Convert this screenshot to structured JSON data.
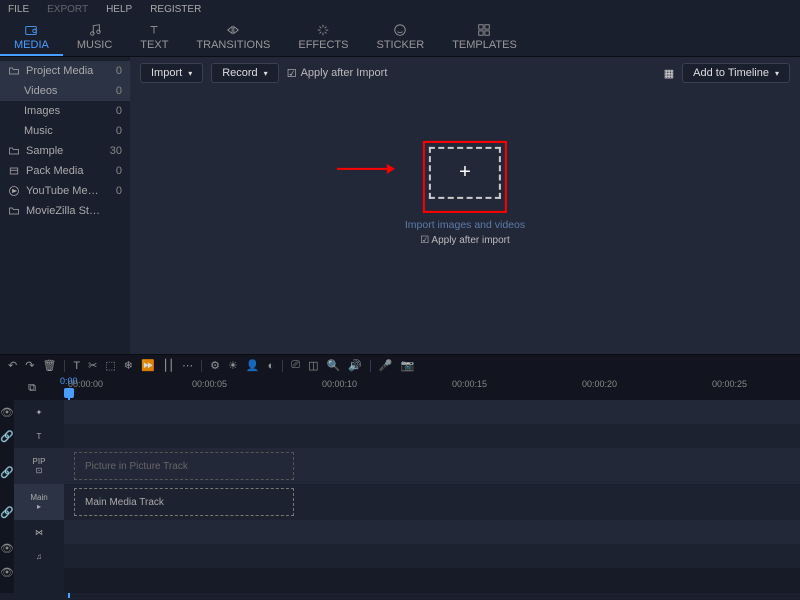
{
  "menu": [
    "FILE",
    "EXPORT",
    "HELP",
    "REGISTER"
  ],
  "tabs": [
    {
      "label": "MEDIA",
      "icon": "media-icon",
      "active": true
    },
    {
      "label": "MUSIC",
      "icon": "music-icon"
    },
    {
      "label": "TEXT",
      "icon": "text-icon"
    },
    {
      "label": "TRANSITIONS",
      "icon": "transitions-icon"
    },
    {
      "label": "EFFECTS",
      "icon": "effects-icon"
    },
    {
      "label": "STICKER",
      "icon": "sticker-icon"
    },
    {
      "label": "TEMPLATES",
      "icon": "templates-icon"
    }
  ],
  "sidebar": [
    {
      "label": "Project Media",
      "count": "0",
      "icon": "folder",
      "selected": true
    },
    {
      "label": "Videos",
      "count": "0",
      "child": true,
      "selected": true
    },
    {
      "label": "Images",
      "count": "0",
      "child": true
    },
    {
      "label": "Music",
      "count": "0",
      "child": true
    },
    {
      "label": "Sample",
      "count": "30",
      "icon": "folder"
    },
    {
      "label": "Pack Media",
      "count": "0",
      "icon": "box"
    },
    {
      "label": "YouTube Me…",
      "count": "0",
      "icon": "play",
      "arrow": true
    },
    {
      "label": "MovieZilla St…",
      "count": "",
      "icon": "folder"
    }
  ],
  "content_toolbar": {
    "import": "Import",
    "record": "Record",
    "apply_after": "Apply after Import",
    "grid_icon": "grid",
    "add_to_timeline": "Add to Timeline"
  },
  "import_area": {
    "caption": "Import images and videos",
    "check": "Apply after import"
  },
  "timeline": {
    "ticks": [
      "00:00:00",
      "00:00:05",
      "00:00:10",
      "00:00:15",
      "00:00:20",
      "00:00:25"
    ],
    "playhead_time": "0:00",
    "pip_label": "PIP",
    "pip_track": "Picture in Picture Track",
    "main_label": "Main",
    "main_track": "Main Media Track"
  }
}
